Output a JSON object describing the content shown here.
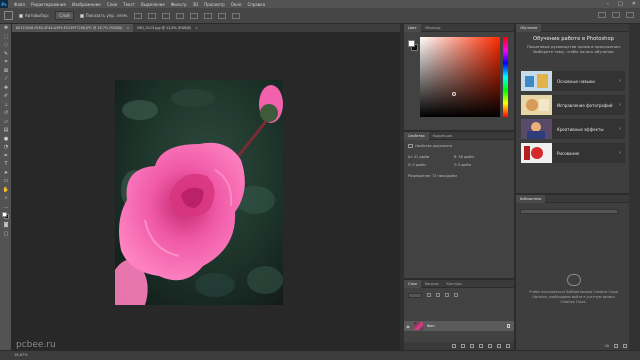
{
  "menubar": {
    "logo": "Ps",
    "items": [
      "Файл",
      "Редактирование",
      "Изображение",
      "Слои",
      "Текст",
      "Выделение",
      "Фильтр",
      "3D",
      "Просмотр",
      "Окно",
      "Справка"
    ],
    "window_controls": [
      "–",
      "□",
      "✕"
    ]
  },
  "options": {
    "auto_select": "Автовыбор:",
    "layer_mode": "Слой",
    "show_controls": "Показать упр. элем."
  },
  "document": {
    "tabs": [
      {
        "title": "80110006-FE63-4F44-A399-E5139F7206.JPG @ 16,7% (RGB/8)",
        "active": true
      },
      {
        "title": "IMG_0113.jpg @ 12,8% (RGB/8)",
        "active": false
      }
    ]
  },
  "status": {
    "zoom": "16,67%",
    "watermark": "pcbee.ru"
  },
  "color_panel": {
    "tabs": [
      "Цвет",
      "Образцы"
    ]
  },
  "properties_panel": {
    "tabs": [
      "Свойства",
      "Коррекция"
    ],
    "section": "Свойства документа",
    "width_label": "Ш:",
    "width_value": "41 дюйм",
    "height_label": "В:",
    "height_value": "56 дюйм",
    "x_label": "X:",
    "x_value": "0 дюйм",
    "y_label": "Y:",
    "y_value": "0 дюйм",
    "resolution": "Разрешение: 72 пикс/дюйм"
  },
  "layers_panel": {
    "tabs": [
      "Слои",
      "Каналы",
      "Контуры"
    ],
    "layers": [
      {
        "name": "Фон",
        "locked": true,
        "visible": true
      }
    ]
  },
  "learn_panel": {
    "tab": "Обучение",
    "title": "Обучение работе в Photoshop",
    "subtitle": "Пошаговые руководства прямо в приложении. Выберите тему, чтобы начать обучение.",
    "cards": [
      {
        "label": "Основные навыки"
      },
      {
        "label": "Исправление фотографий"
      },
      {
        "label": "Креативные эффекты"
      },
      {
        "label": "Рисование"
      }
    ]
  },
  "libraries_panel": {
    "tab": "Библиотеки",
    "message": "Чтобы пользоваться библиотеками Creative Cloud Libraries, необходимо войти в учетную запись Creative Cloud.",
    "count": "48"
  }
}
